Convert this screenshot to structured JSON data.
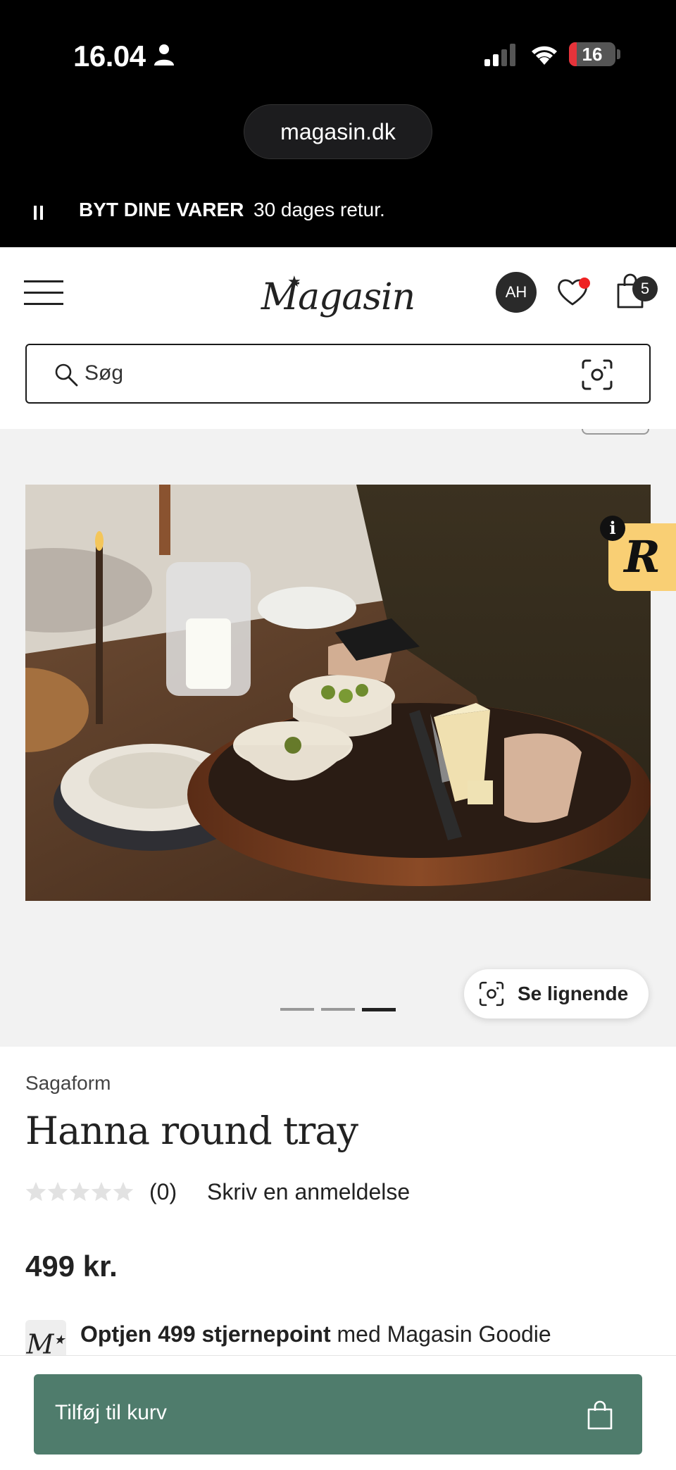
{
  "status_bar": {
    "time": "16.04",
    "battery": "16",
    "battery_level": 0.16
  },
  "browser": {
    "url": "magasin.dk"
  },
  "promo": {
    "title": "BYT DINE VARER",
    "text": "30 dages retur."
  },
  "header": {
    "logo": "Magasin",
    "avatar_initials": "AH",
    "cart_count": "5"
  },
  "search": {
    "placeholder": "Søg"
  },
  "gallery": {
    "total_images": 3,
    "active_index": 2,
    "similar_label": "Se lignende",
    "badge_letter": "R",
    "badge_info": "i"
  },
  "product": {
    "brand": "Sagaform",
    "title": "Hanna round tray",
    "rating": 0,
    "review_count": "(0)",
    "write_review": "Skriv en anmeldelse",
    "price": "499 kr.",
    "goodie_logo": "M",
    "goodie_bold": "Optjen 499 stjernepoint",
    "goodie_rest": " med Magasin Goodie"
  },
  "cta": {
    "add_to_cart": "Tilføj til kurv"
  },
  "colors": {
    "accent_green": "#4f7c6c",
    "badge_yellow": "#f9cf74",
    "notification_red": "#e22222"
  }
}
